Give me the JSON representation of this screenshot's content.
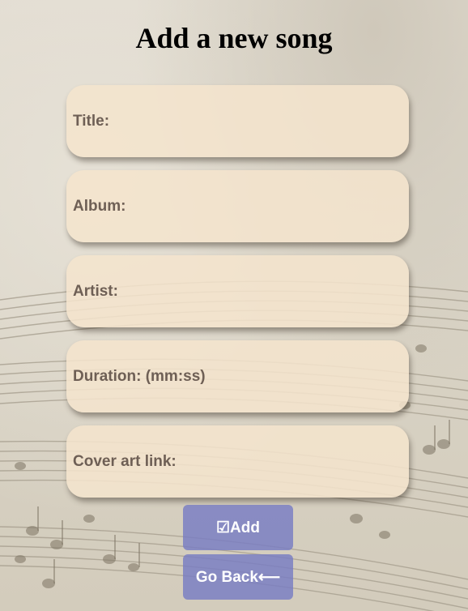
{
  "page": {
    "title": "Add a new song"
  },
  "form": {
    "fields": [
      {
        "label": "Title:",
        "value": ""
      },
      {
        "label": "Album:",
        "value": ""
      },
      {
        "label": "Artist:",
        "value": ""
      },
      {
        "label": "Duration: (mm:ss)",
        "value": ""
      },
      {
        "label": "Cover art link:",
        "value": ""
      }
    ]
  },
  "buttons": {
    "add_label": "☑Add",
    "back_label": "Go Back⟵"
  },
  "colors": {
    "field_background": "#f5e4cd",
    "label_text": "#6e5f55",
    "button_background": "#787dc3",
    "button_text": "#ffffff"
  }
}
